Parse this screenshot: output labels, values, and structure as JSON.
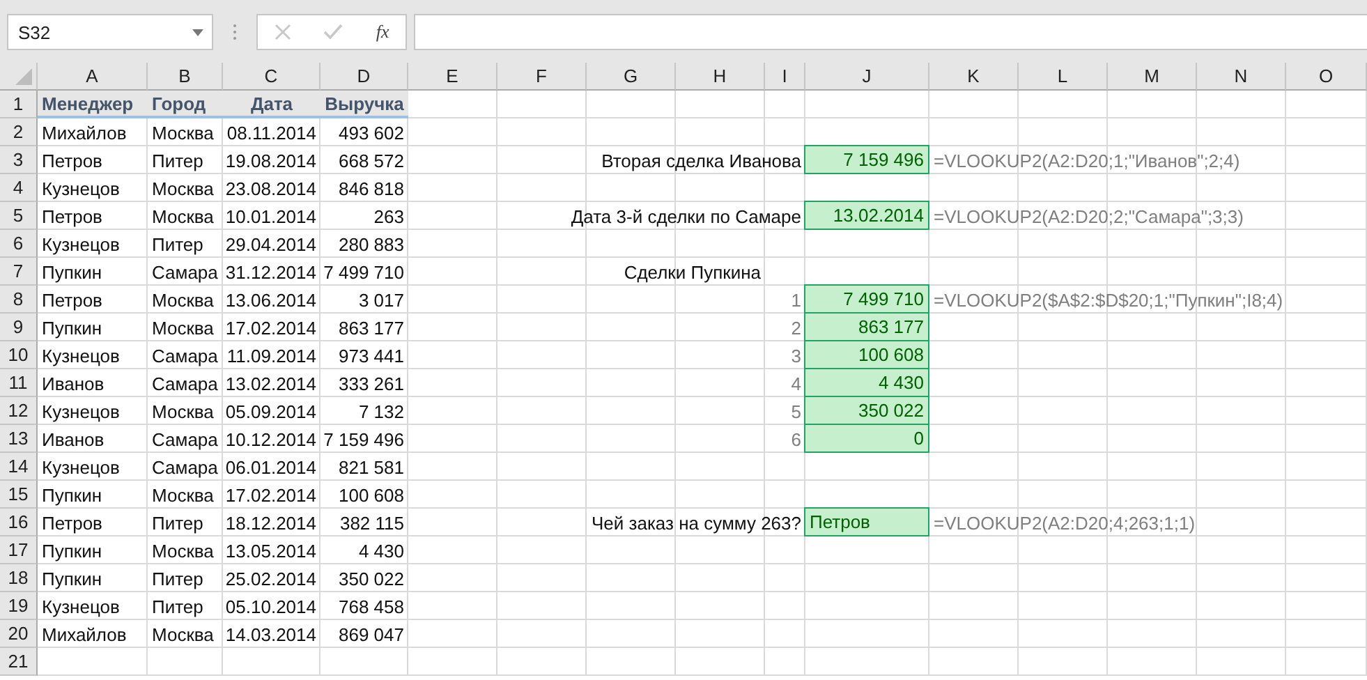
{
  "name_box": {
    "value": "S32"
  },
  "formula_buttons": [
    {
      "kind": "cancel",
      "disabled": true
    },
    {
      "kind": "enter",
      "disabled": true
    },
    {
      "kind": "function",
      "label": "fx",
      "disabled": false
    }
  ],
  "columns": [
    "A",
    "B",
    "C",
    "D",
    "E",
    "F",
    "G",
    "H",
    "I",
    "J",
    "K",
    "L",
    "M",
    "N",
    "O"
  ],
  "row_numbers": [
    "1",
    "2",
    "3",
    "4",
    "5",
    "6",
    "7",
    "8",
    "9",
    "10",
    "11",
    "12",
    "13",
    "14",
    "15",
    "16",
    "17",
    "18",
    "19",
    "20",
    "21"
  ],
  "table": {
    "header": [
      "Менеджер",
      "Город",
      "Дата",
      "Выручка"
    ],
    "rows": [
      [
        "Михайлов",
        "Москва",
        "08.11.2014",
        "493 602"
      ],
      [
        "Петров",
        "Питер",
        "19.08.2014",
        "668 572"
      ],
      [
        "Кузнецов",
        "Москва",
        "23.08.2014",
        "846 818"
      ],
      [
        "Петров",
        "Москва",
        "10.01.2014",
        "263"
      ],
      [
        "Кузнецов",
        "Питер",
        "29.04.2014",
        "280 883"
      ],
      [
        "Пупкин",
        "Самара",
        "31.12.2014",
        "7 499 710"
      ],
      [
        "Петров",
        "Москва",
        "13.06.2014",
        "3 017"
      ],
      [
        "Пупкин",
        "Москва",
        "17.02.2014",
        "863 177"
      ],
      [
        "Кузнецов",
        "Самара",
        "11.09.2014",
        "973 441"
      ],
      [
        "Иванов",
        "Самара",
        "13.02.2014",
        "333 261"
      ],
      [
        "Кузнецов",
        "Москва",
        "05.09.2014",
        "7 132"
      ],
      [
        "Иванов",
        "Самара",
        "10.12.2014",
        "7 159 496"
      ],
      [
        "Кузнецов",
        "Самара",
        "06.01.2014",
        "821 581"
      ],
      [
        "Пупкин",
        "Москва",
        "17.02.2014",
        "100 608"
      ],
      [
        "Петров",
        "Питер",
        "18.12.2014",
        "382 115"
      ],
      [
        "Пупкин",
        "Москва",
        "13.05.2014",
        "4 430"
      ],
      [
        "Пупкин",
        "Питер",
        "25.02.2014",
        "350 022"
      ],
      [
        "Кузнецов",
        "Питер",
        "05.10.2014",
        "768 458"
      ],
      [
        "Михайлов",
        "Москва",
        "14.03.2014",
        "869 047"
      ]
    ]
  },
  "lookups": [
    {
      "kind": "single",
      "label": "Вторая сделка Иванова",
      "result": "7 159 496",
      "formula": "=VLOOKUP2(A2:D20;1;\"Иванов\";2;4)"
    },
    {
      "kind": "single",
      "label": "Дата 3-й сделки по Самаре",
      "result": "13.02.2014",
      "formula": "=VLOOKUP2(A2:D20;2;\"Самара\";3;3)"
    },
    {
      "kind": "list",
      "label": "Сделки Пупкина",
      "formula": "=VLOOKUP2($A$2:$D$20;1;\"Пупкин\";I8;4)",
      "items": [
        {
          "index": "1",
          "result": "7 499 710"
        },
        {
          "index": "2",
          "result": "863 177"
        },
        {
          "index": "3",
          "result": "100 608"
        },
        {
          "index": "4",
          "result": "4 430"
        },
        {
          "index": "5",
          "result": "350 022"
        },
        {
          "index": "6",
          "result": "0"
        }
      ]
    },
    {
      "kind": "reverse",
      "label": "Чей заказ на сумму 263?",
      "result": "Петров",
      "formula": "=VLOOKUP2(A2:D20;4;263;1;1)"
    }
  ]
}
